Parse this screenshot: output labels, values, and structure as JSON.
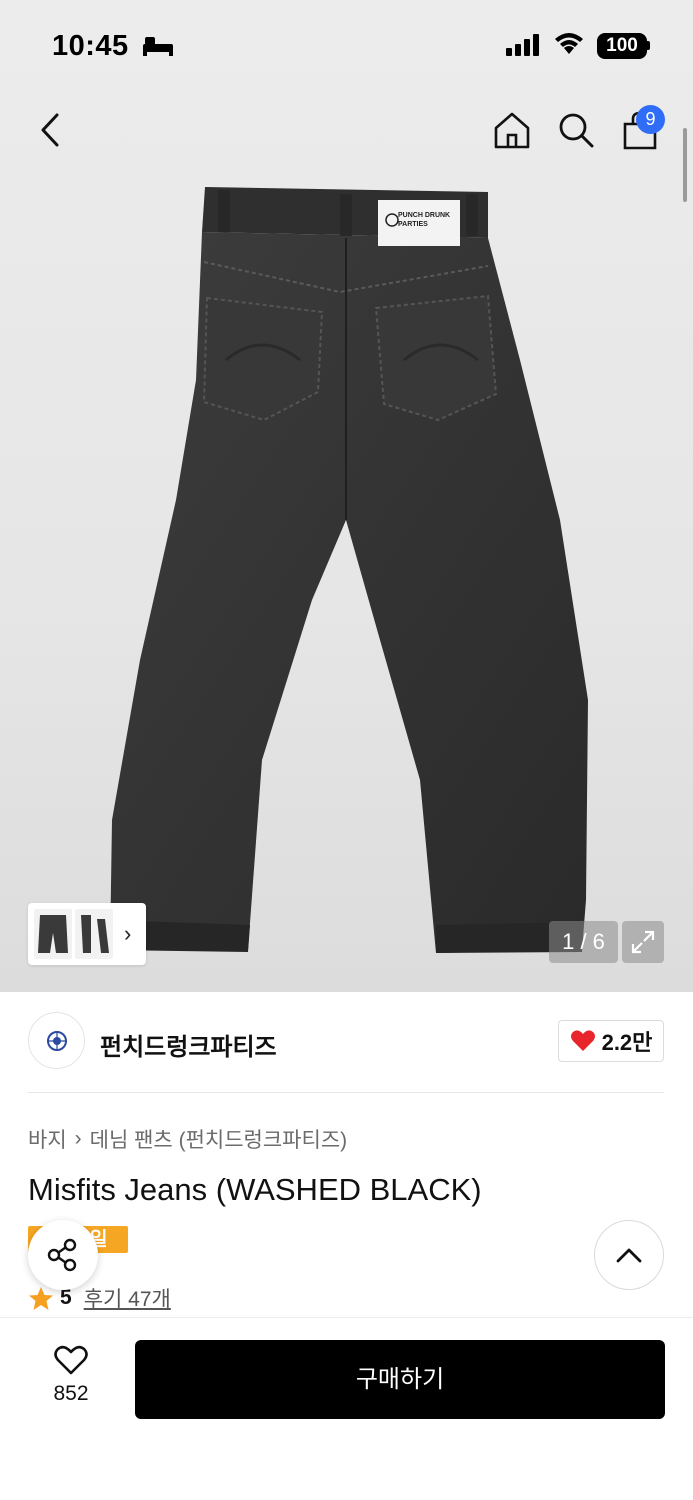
{
  "status_bar": {
    "time": "10:45",
    "battery": "100",
    "icons": [
      "sleep-icon",
      "cellular-signal-icon",
      "wifi-icon",
      "battery-icon"
    ]
  },
  "nav": {
    "icons": [
      "chevron-left-icon",
      "home-icon",
      "search-icon",
      "shopping-bag-icon"
    ],
    "cart_count": "9"
  },
  "gallery": {
    "counter": "1 / 6",
    "label_patch_text": "PUNCH DRUNK PARTIES"
  },
  "brand": {
    "name": "펀치드렁크파티즈",
    "likes": "2.2만"
  },
  "product": {
    "breadcrumb": [
      "바지",
      "데님 팬츠 (펀치드렁크파티즈)"
    ],
    "title": "Misfits Jeans (WASHED BLACK)",
    "sale_badge": "일",
    "rating": "5",
    "reviews": "후기 47개"
  },
  "bottom": {
    "wish_count": "852",
    "buy_label": "구매하기"
  },
  "colors": {
    "accent_blue": "#2f6df6",
    "sale_orange": "#f5a623",
    "heart_red": "#e8252b",
    "star_orange": "#f5a020"
  }
}
